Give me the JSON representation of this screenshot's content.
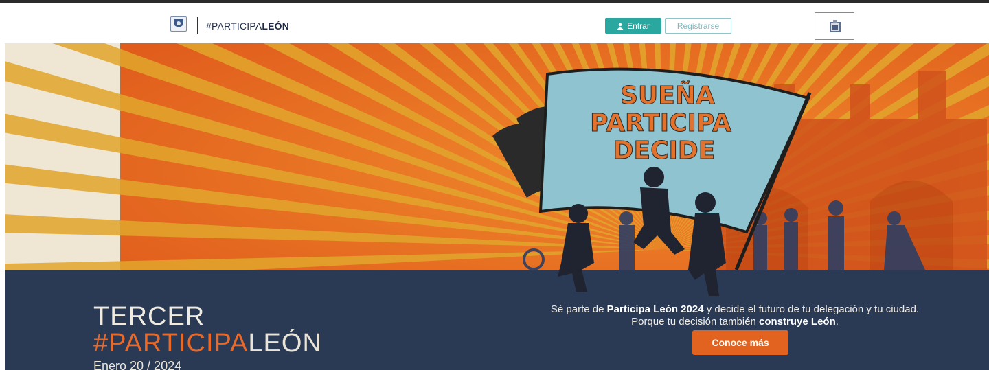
{
  "header": {
    "brand_prefix": "#PARTICIPA",
    "brand_suffix": "LEÓN",
    "login_label": "Entrar",
    "register_label": "Registrarse"
  },
  "banner": {
    "slogan_line1": "SUEÑA",
    "slogan_line2": "PARTICIPA",
    "slogan_line3": "DECIDE"
  },
  "hero": {
    "heading_line1": "TERCER",
    "heading_hashtag_prefix": "#PARTICIPA",
    "heading_hashtag_suffix": "LEÓN",
    "date": "Enero 20 / 2024",
    "msg_part1": "Sé parte de ",
    "msg_bold1": "Participa León 2024",
    "msg_part2": " y decide el futuro de tu delegación y tu ciudad.",
    "msg_part3": "Porque tu decisión también ",
    "msg_bold2": "construye León",
    "msg_part4": ".",
    "cta_label": "Conoce más"
  },
  "colors": {
    "accent_teal": "#2aa8a0",
    "accent_orange": "#e1631f",
    "navy": "#2a3a55",
    "cream": "#efe6d3"
  },
  "icons": [
    "crest-icon",
    "user-icon",
    "city-logo-icon"
  ]
}
